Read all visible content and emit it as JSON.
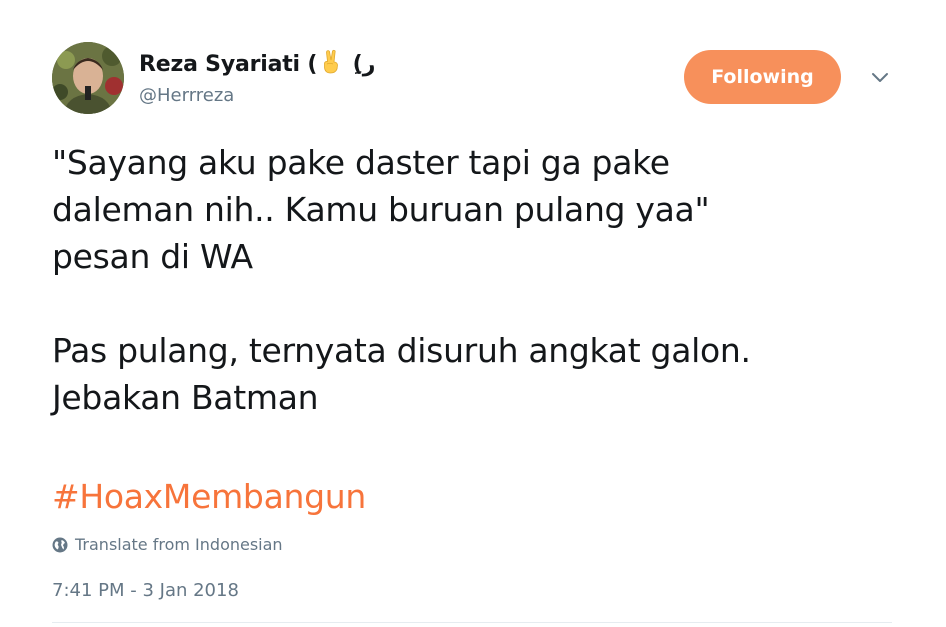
{
  "tweet": {
    "author": {
      "name_prefix": "Reza Syariati (",
      "name_emoji": "victory-hand-emoji",
      "name_suffix": " (ِر",
      "handle": "@Herrreza",
      "avatar_icon": "user-avatar"
    },
    "follow_button_label": "Following",
    "menu_icon": "chevron-down-icon",
    "text": "\"Sayang aku pake daster tapi ga pake\ndaleman nih.. Kamu buruan pulang yaa\"\npesan di WA\n\nPas pulang, ternyata disuruh angkat galon.\nJebakan Batman",
    "hashtag": "#HoaxMembangun",
    "translate_label": "Translate from Indonesian",
    "translate_icon": "globe-icon",
    "timestamp": "7:41 PM - 3 Jan 2018"
  },
  "colors": {
    "accent": "#f7905b",
    "hashtag": "#f7743b",
    "text_primary": "#14171a",
    "text_secondary": "#657786"
  }
}
